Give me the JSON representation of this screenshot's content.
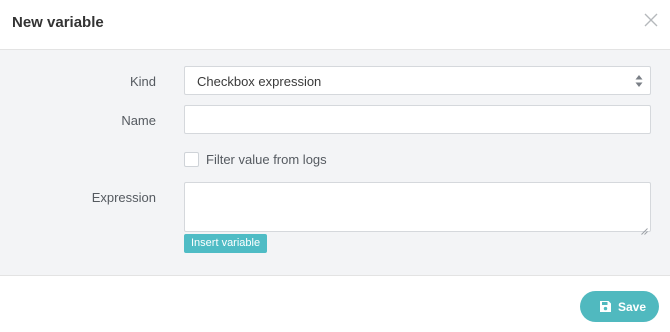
{
  "dialog": {
    "title": "New variable",
    "close_icon": "close-icon"
  },
  "form": {
    "kind": {
      "label": "Kind",
      "selected": "Checkbox expression",
      "icon": "select-arrows-icon"
    },
    "name": {
      "label": "Name",
      "value": "",
      "placeholder": ""
    },
    "filter_logs": {
      "label": "Filter value from logs",
      "checked": false
    },
    "expression": {
      "label": "Expression",
      "value": ""
    },
    "insert_variable_label": "Insert variable"
  },
  "footer": {
    "save_label": "Save",
    "save_icon": "floppy-disk-icon"
  },
  "colors": {
    "accent": "#4fbcc5",
    "panel_background": "#f3f4f6"
  }
}
